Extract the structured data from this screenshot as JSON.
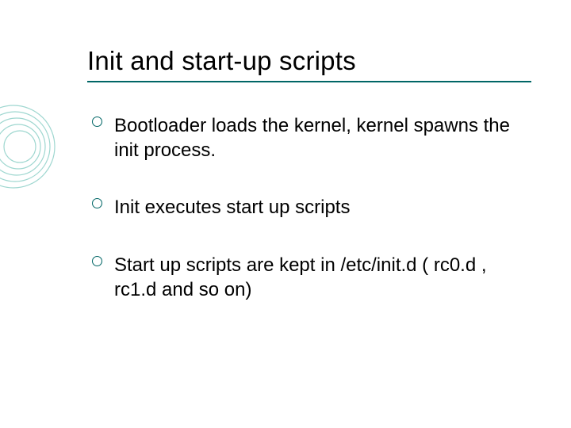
{
  "title": "Init and start-up scripts",
  "bullets": [
    "Bootloader loads the kernel, kernel spawns the init process.",
    "Init executes start up scripts",
    "Start up scripts are kept in /etc/init.d ( rc0.d , rc1.d and so on)"
  ]
}
